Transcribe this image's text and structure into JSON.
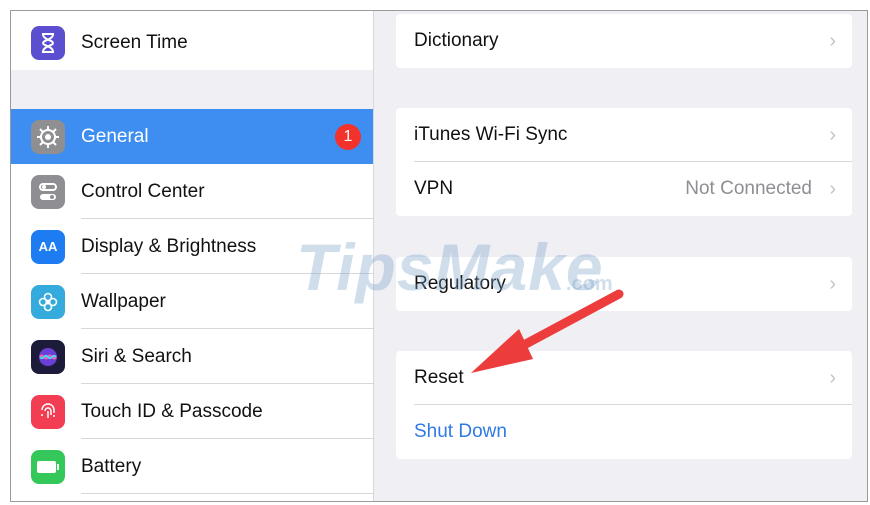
{
  "sidebar": {
    "items": [
      {
        "label": "Screen Time",
        "icon": "hourglass-icon",
        "color": "#5b4fcf"
      },
      {
        "label": "General",
        "icon": "gear-icon",
        "color": "#8e8e93",
        "badge": "1"
      },
      {
        "label": "Control Center",
        "icon": "toggles-icon",
        "color": "#8e8e93"
      },
      {
        "label": "Display & Brightness",
        "icon": "text-size-icon",
        "color": "#1e7cf2"
      },
      {
        "label": "Wallpaper",
        "icon": "flower-icon",
        "color": "#35aadc"
      },
      {
        "label": "Siri & Search",
        "icon": "siri-icon",
        "color": "#1c1c3a"
      },
      {
        "label": "Touch ID & Passcode",
        "icon": "fingerprint-icon",
        "color": "#f23d52"
      },
      {
        "label": "Battery",
        "icon": "battery-icon",
        "color": "#34c759"
      }
    ]
  },
  "detail": {
    "groups": [
      {
        "rows": [
          {
            "label": "Dictionary"
          }
        ]
      },
      {
        "rows": [
          {
            "label": "iTunes Wi-Fi Sync"
          },
          {
            "label": "VPN",
            "value": "Not Connected"
          }
        ]
      },
      {
        "rows": [
          {
            "label": "Regulatory"
          }
        ]
      },
      {
        "rows": [
          {
            "label": "Reset"
          },
          {
            "label": "Shut Down"
          }
        ]
      }
    ]
  },
  "watermark": {
    "text": "TipsMake",
    "suffix": ".com"
  },
  "annotation": {
    "type": "red-arrow",
    "color": "#ec3c3c"
  },
  "colors": {
    "selected": "#3d8ef0",
    "link": "#2f7ae5",
    "badge": "#f2322b",
    "background": "#efeff4"
  }
}
